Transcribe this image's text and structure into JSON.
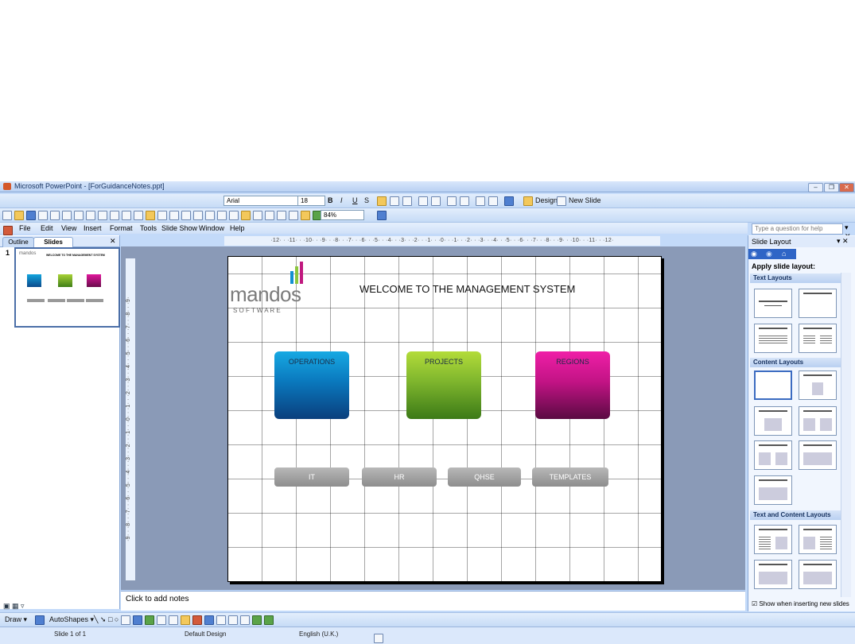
{
  "window": {
    "title": "Microsoft PowerPoint - [ForGuidanceNotes.ppt]"
  },
  "formatting": {
    "font": "Arial",
    "size": "18",
    "design_label": "Design",
    "new_slide_label": "New Slide"
  },
  "standard": {
    "zoom": "84%"
  },
  "menu": [
    "File",
    "Edit",
    "View",
    "Insert",
    "Format",
    "Tools",
    "Slide Show",
    "Window",
    "Help"
  ],
  "help_box": {
    "placeholder": "Type a question for help"
  },
  "left_pane": {
    "tab_outline": "Outline",
    "tab_slides": "Slides",
    "slide_number": "1"
  },
  "ruler": {
    "horizontal": "·12· · ·11· · ·10· · ·9· · ·8· · ·7· · ·6· · ·5· · ·4· · ·3· · ·2· · ·1· · ·0· · ·1· · ·2· · ·3· · ·4· · ·5· · ·6· · ·7· · ·8· · ·9· · ·10· · ·11· · ·12·",
    "vertical": "·9· · ·8· · ·7· · ·6· · ·5· · ·4· · ·3· · ·2· · ·1· · ·0· · ·1· · ·2· · ·3· · ·4· · ·5· · ·6· · ·7· · ·8· · ·9·"
  },
  "slide": {
    "logo_main": "mandos",
    "logo_sub": "S O F T W A R E",
    "title": "WELCOME TO THE MANAGEMENT SYSTEM",
    "tiles": [
      "OPERATIONS",
      "PROJECTS",
      "REGIONS"
    ],
    "buttons": [
      "IT",
      "HR",
      "QHSE",
      "TEMPLATES"
    ],
    "thumb_title": "WELCOME TO THE MANAGEMENT SYSTEM"
  },
  "notes": {
    "placeholder": "Click to add notes"
  },
  "task_pane": {
    "title": "Slide Layout",
    "apply_label": "Apply slide layout:",
    "sections": [
      "Text Layouts",
      "Content Layouts",
      "Text and Content Layouts"
    ],
    "show_checkbox": "Show when inserting new slides"
  },
  "drawing": {
    "draw_label": "Draw",
    "autoshapes_label": "AutoShapes"
  },
  "status": {
    "slide": "Slide 1 of 1",
    "design": "Default Design",
    "language": "English (U.K.)"
  },
  "colors": {
    "operations": "#0a6fb0",
    "projects": "#6aa628",
    "regions": "#b0167a",
    "chrome": "#c3daf9"
  }
}
